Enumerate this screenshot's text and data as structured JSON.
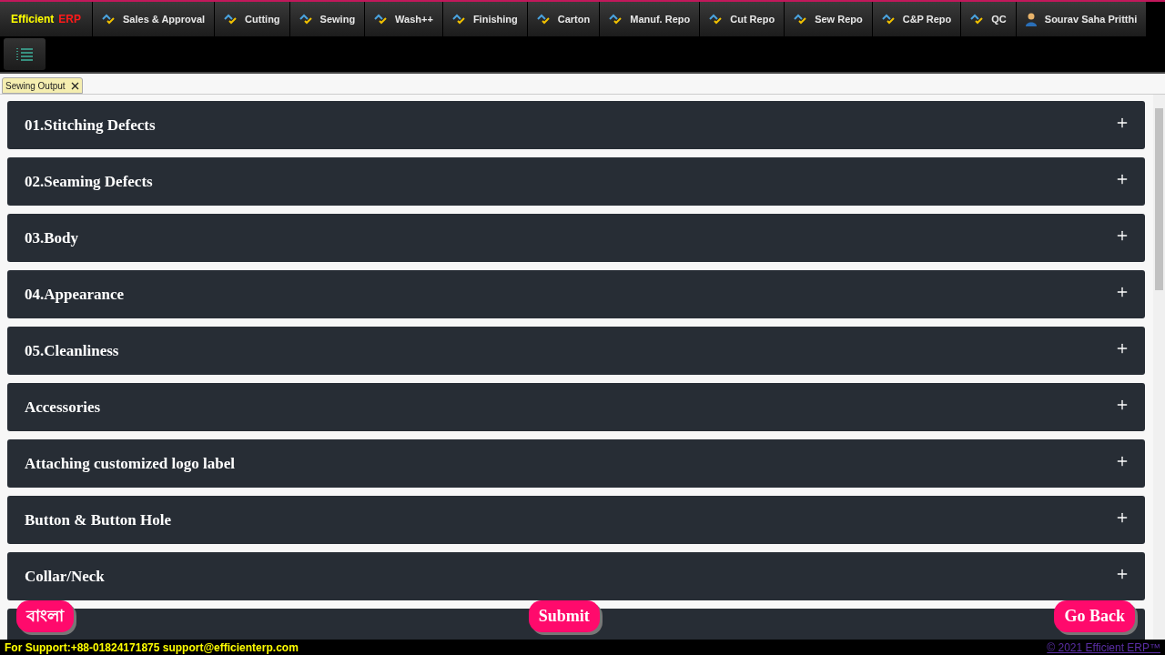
{
  "brand": {
    "part_1": "Efficient",
    "part_2": "ERP"
  },
  "nav_tabs": [
    {
      "label": "Sales & Approval",
      "kind": "module"
    },
    {
      "label": "Cutting",
      "kind": "module"
    },
    {
      "label": "Sewing",
      "kind": "module"
    },
    {
      "label": "Wash++",
      "kind": "module"
    },
    {
      "label": "Finishing",
      "kind": "module"
    },
    {
      "label": "Carton",
      "kind": "module"
    },
    {
      "label": "Manuf. Repo",
      "kind": "module"
    },
    {
      "label": "Cut Repo",
      "kind": "module"
    },
    {
      "label": "Sew Repo",
      "kind": "module"
    },
    {
      "label": "C&P Repo",
      "kind": "module"
    },
    {
      "label": "QC",
      "kind": "module"
    },
    {
      "label": "Sourav Saha Pritthi",
      "kind": "user"
    }
  ],
  "doc_tabs": [
    {
      "label": "Sewing Output",
      "selected": true
    }
  ],
  "sections": [
    {
      "title": "01.Stitching Defects",
      "expanded": false
    },
    {
      "title": "02.Seaming Defects",
      "expanded": false
    },
    {
      "title": "03.Body",
      "expanded": false
    },
    {
      "title": "04.Appearance",
      "expanded": false
    },
    {
      "title": "05.Cleanliness",
      "expanded": false
    },
    {
      "title": "Accessories",
      "expanded": false
    },
    {
      "title": "Attaching customized logo label",
      "expanded": false
    },
    {
      "title": "Button & Button Hole",
      "expanded": false
    },
    {
      "title": "Collar/Neck",
      "expanded": false
    }
  ],
  "actions": [
    {
      "label": "বাংলা"
    },
    {
      "label": "Submit"
    },
    {
      "label": "Go Back"
    }
  ],
  "footer": {
    "support": "For Support:+88-01824171875 support@efficienterp.com",
    "copyright": "© 2021 Efficient ERP™"
  }
}
